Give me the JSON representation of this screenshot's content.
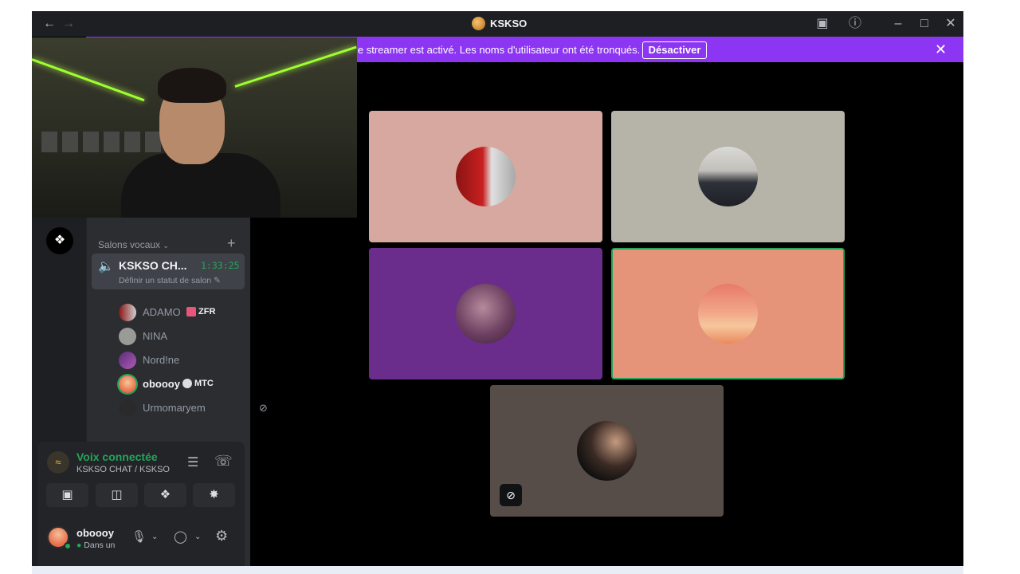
{
  "window": {
    "title": "KSKSO",
    "back_icon": "arrow-left-icon",
    "forward_icon": "arrow-right-icon"
  },
  "banner": {
    "text": "le streamer est activé. Les noms d'utilisateur ont été tronqués.",
    "button_label": "Désactiver",
    "accent": "#8c35f2"
  },
  "sidebar": {
    "section_label": "Salons vocaux",
    "channel": {
      "name": "KSKSO CH...",
      "timer": "1:33:25",
      "status_placeholder": "Définir un statut de salon"
    },
    "members": [
      {
        "name": "ADAMO",
        "badge": "ZFR",
        "color": "#8a1414"
      },
      {
        "name": "NINA",
        "badge": "",
        "color": "#9a9a96"
      },
      {
        "name": "Nord!ne",
        "badge": "",
        "color": "#7b3ea0"
      },
      {
        "name": "oboooy",
        "badge": "MTC",
        "color": "#e88b6a"
      },
      {
        "name": "Urmomaryem",
        "badge": "",
        "color": "#2a2a2a"
      }
    ]
  },
  "voice_panel": {
    "title": "Voix connectée",
    "subtitle": "KSKSO CHAT / KSKSO",
    "user_name": "oboooy",
    "user_status": "Dans un"
  },
  "tiles": [
    {
      "bg": "#d7a89f",
      "avatar": "red-anime-avatar"
    },
    {
      "bg": "#b6b3a8",
      "avatar": "mirror-selfie-avatar"
    },
    {
      "bg": "#6a2d8c",
      "avatar": "purple-portrait-avatar"
    },
    {
      "bg": "#e69479",
      "avatar": "sunset-avatar",
      "speaking": true
    },
    {
      "bg": "#574d48",
      "avatar": "dark-portrait-avatar",
      "muted": true
    }
  ]
}
